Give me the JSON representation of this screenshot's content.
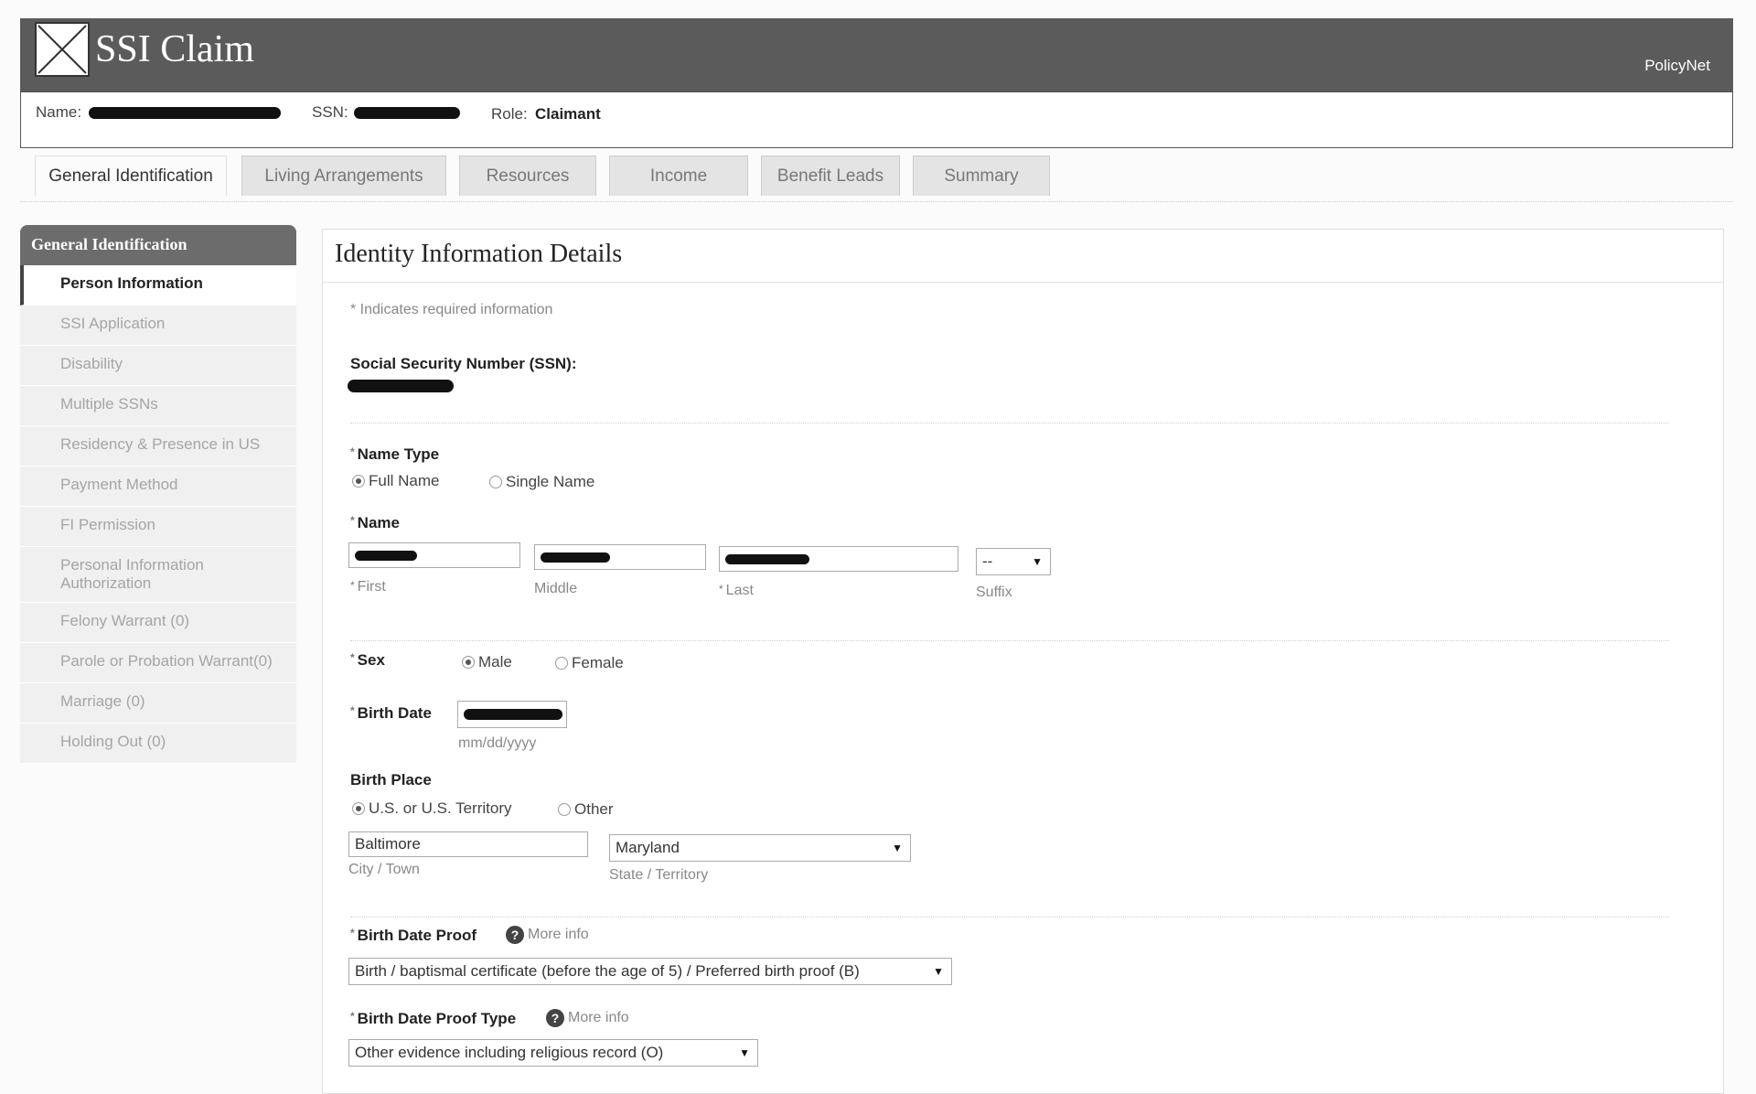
{
  "header": {
    "app_title": "SSI Claim",
    "right_link": "PolicyNet"
  },
  "user_bar": {
    "name_label": "Name:",
    "ssn_label": "SSN:",
    "role_label": "Role:",
    "role_value": "Claimant"
  },
  "tabs": [
    {
      "label": "General Identification"
    },
    {
      "label": "Living Arrangements"
    },
    {
      "label": "Resources"
    },
    {
      "label": "Income"
    },
    {
      "label": "Benefit Leads"
    },
    {
      "label": "Summary"
    }
  ],
  "sidebar": {
    "heading": "General Identification",
    "items": [
      {
        "label": "Person Information"
      },
      {
        "label": "SSI Application"
      },
      {
        "label": "Disability"
      },
      {
        "label": "Multiple SSNs"
      },
      {
        "label": "Residency & Presence in US"
      },
      {
        "label": "Payment Method"
      },
      {
        "label": "FI Permission"
      },
      {
        "label": "Personal Information Authorization"
      },
      {
        "label": "Felony Warrant (0)"
      },
      {
        "label": "Parole or Probation Warrant(0)"
      },
      {
        "label": "Marriage (0)"
      },
      {
        "label": "Holding Out (0)"
      }
    ]
  },
  "form": {
    "title": "Identity Information Details",
    "required_note": "* Indicates required information",
    "ssn_label": "Social Security Number (SSN):",
    "name_type": {
      "label": "Name Type",
      "options": [
        "Full Name",
        "Single Name"
      ],
      "selected": "Full Name"
    },
    "name": {
      "label": "Name",
      "first_label": "First",
      "middle_label": "Middle",
      "last_label": "Last",
      "suffix_label": "Suffix",
      "suffix_value": "--"
    },
    "sex": {
      "label": "Sex",
      "options": [
        "Male",
        "Female"
      ],
      "selected": "Male"
    },
    "birth_date": {
      "label": "Birth Date",
      "format_hint": "mm/dd/yyyy"
    },
    "birth_place": {
      "label": "Birth Place",
      "options": [
        "U.S. or U.S. Territory",
        "Other"
      ],
      "selected": "U.S. or U.S. Territory",
      "city_value": "Baltimore",
      "city_label": "City / Town",
      "state_value": "Maryland",
      "state_label": "State / Territory"
    },
    "birth_date_proof": {
      "label": "Birth Date Proof",
      "more_info": "More info",
      "value": "Birth / baptismal certificate (before the age of 5) / Preferred birth proof (B)"
    },
    "birth_date_proof_type": {
      "label": "Birth Date Proof Type",
      "more_info": "More info",
      "value": "Other evidence including religious record (O)"
    }
  },
  "colors": {
    "header_bg": "#5b5b5b",
    "sidebar_head_bg": "#6c6c6c",
    "tab_inactive_bg": "#e4e4e4"
  }
}
